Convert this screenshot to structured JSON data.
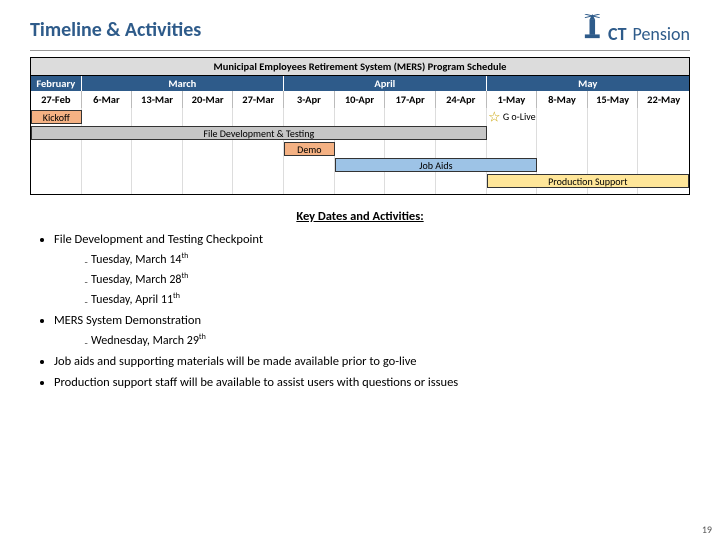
{
  "logo": {
    "text1": "CT",
    "text2": "Pension"
  },
  "title": "Timeline & Activities",
  "chart_data": {
    "type": "table",
    "title": "Municipal Employees Retirement System (MERS) Program Schedule",
    "months": [
      "February",
      "March",
      "April",
      "May"
    ],
    "dates": [
      "27-Feb",
      "6-Mar",
      "13-Mar",
      "20-Mar",
      "27-Mar",
      "3-Apr",
      "10-Apr",
      "17-Apr",
      "24-Apr",
      "1-May",
      "8-May",
      "15-May",
      "22-May"
    ],
    "tasks": {
      "kickoff": "Kickoff",
      "golive": "G o-Live",
      "filedev": "File Development & Testing",
      "demo": "Demo",
      "jobaids": "Job Aids",
      "prodsupp": "Production Support"
    }
  },
  "key": {
    "heading": "Key Dates and Activities:",
    "b1": "File Development and Testing Checkpoint",
    "b1a": "Tuesday, March 14",
    "b1b": "Tuesday, March 28",
    "b1c": "Tuesday, April 11",
    "th": "th",
    "b2": "MERS System Demonstration",
    "b2a": "Wednesday, March 29",
    "b3": "Job aids and supporting materials will be made available prior to go-live",
    "b4": "Production support staff will be available to assist users with questions or issues"
  },
  "page": "19"
}
